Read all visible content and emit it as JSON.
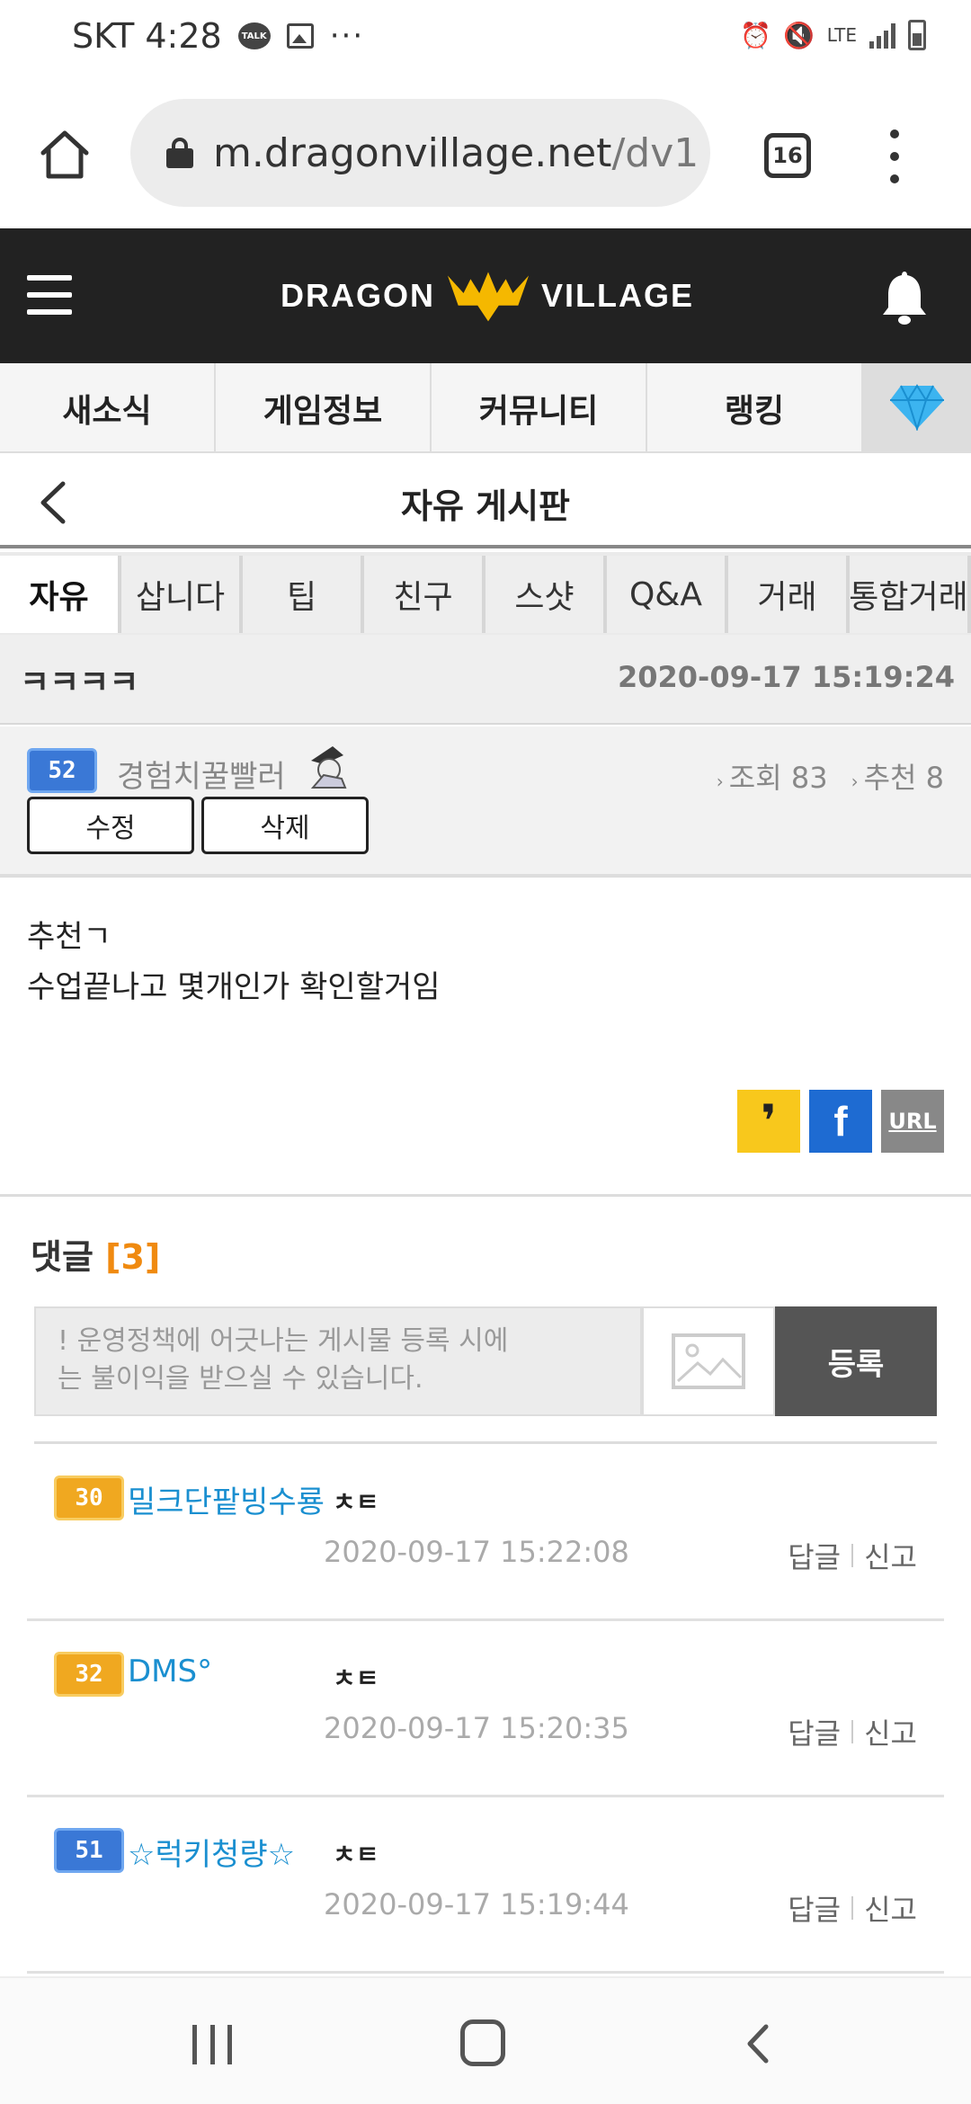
{
  "status_bar": {
    "carrier_time": "SKT 4:28",
    "talk_badge": "TALK",
    "more": "···",
    "lte": "LTE"
  },
  "browser": {
    "url_domain": "m.dragonvillage.net",
    "url_path": "/dv1",
    "tab_count": "16"
  },
  "site": {
    "logo_left": "DRAGON",
    "logo_right": "VILLAGE",
    "brand_color": "#f5b800"
  },
  "nav": {
    "tabs": [
      "새소식",
      "게임정보",
      "커뮤니티",
      "랭킹"
    ],
    "gem_icon": "diamond-icon"
  },
  "board": {
    "title": "자유 게시판"
  },
  "categories": [
    "자유",
    "삽니다",
    "팁",
    "친구",
    "스샷",
    "Q&A",
    "거래",
    "통합거래"
  ],
  "post": {
    "title": "ㅋㅋㅋㅋ",
    "date": "2020-09-17 15:19:24",
    "author": {
      "level": "52",
      "name": "경험치꿀빨러"
    },
    "views": "조회 83",
    "recommends": "추천 8",
    "edit_label": "수정",
    "delete_label": "삭제",
    "body_lines": [
      "추천ㄱ",
      "수업끝나고 몇개인가 확인할거임"
    ],
    "share": {
      "kakao": "❜",
      "facebook": "f",
      "url": "URL"
    }
  },
  "comments": {
    "heading": "댓글",
    "count": "[3]",
    "input_placeholder_line1": "! 운영정책에 어긋나는 게시물 등록 시에",
    "input_placeholder_line2": "는 불이익을 받으실 수 있습니다.",
    "submit_label": "등록",
    "reply_label": "답글",
    "report_label": "신고",
    "items": [
      {
        "level": "30",
        "name": "밀크단팥빙수룡",
        "text": "ㅊㅌ",
        "time": "2020-09-17 15:22:08",
        "badge_color": "#f0a820"
      },
      {
        "level": "32",
        "name": "DMS°",
        "text": "ㅊㅌ",
        "time": "2020-09-17 15:20:35",
        "badge_color": "#f0a820"
      },
      {
        "level": "51",
        "name": "☆럭키청량☆",
        "text": "ㅊㅌ",
        "time": "2020-09-17 15:19:44",
        "badge_color": "#3a78d6"
      }
    ]
  }
}
